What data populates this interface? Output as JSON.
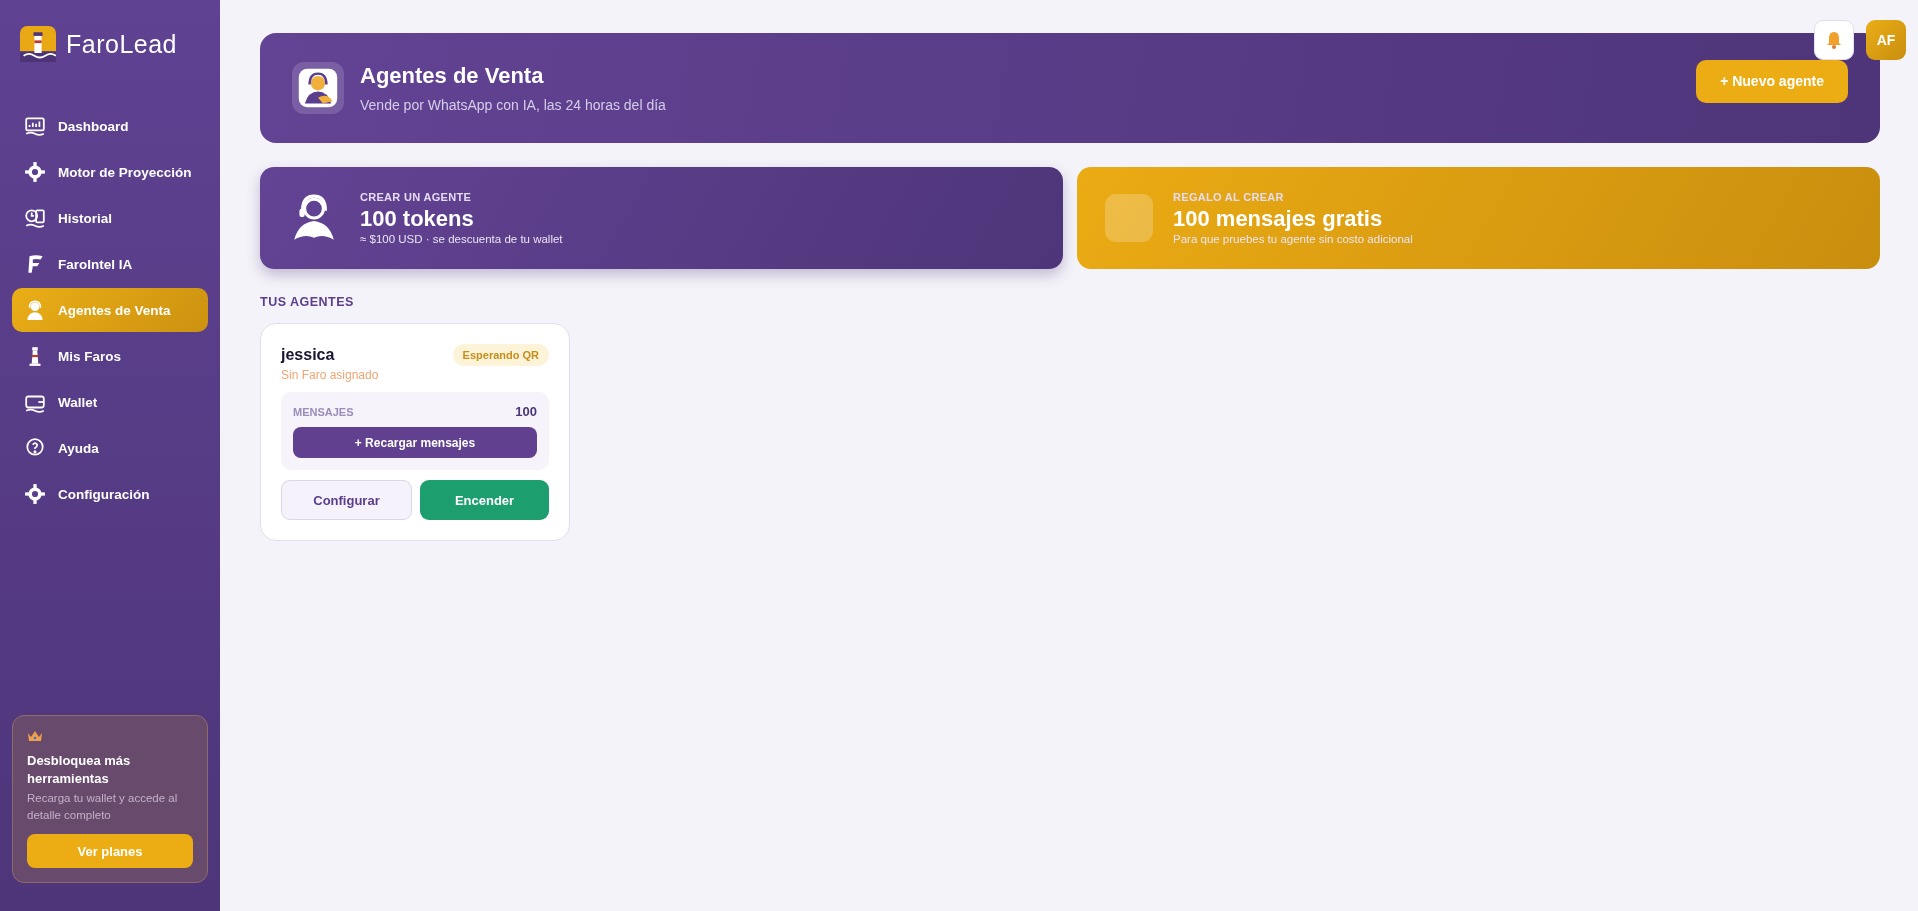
{
  "brand": {
    "name": "FaroLead"
  },
  "sidebar": {
    "items": [
      {
        "label": "Dashboard",
        "selected": false
      },
      {
        "label": "Motor de Proyección",
        "selected": false
      },
      {
        "label": "Historial",
        "selected": false
      },
      {
        "label": "FaroIntel IA",
        "selected": false
      },
      {
        "label": "Agentes de Venta",
        "selected": true
      },
      {
        "label": "Mis Faros",
        "selected": false
      },
      {
        "label": "Wallet",
        "selected": false
      },
      {
        "label": "Ayuda",
        "selected": false
      },
      {
        "label": "Configuración",
        "selected": false
      }
    ],
    "promo": {
      "title": "Desbloquea más herramientas",
      "text": "Recarga tu wallet y accede al detalle completo",
      "button": "Ver planes"
    }
  },
  "topbar": {
    "avatar": "AF"
  },
  "header": {
    "title": "Agentes de Venta",
    "subtitle": "Vende por WhatsApp con IA, las 24 horas del día",
    "button": "+ Nuevo agente"
  },
  "stats": [
    {
      "kind": "purple",
      "eyebrow": "CREAR UN AGENTE",
      "value": "100 tokens",
      "note": "≈ $100 USD · se descuenta de tu wallet"
    },
    {
      "kind": "gold",
      "eyebrow": "REGALO AL CREAR",
      "value": "100 mensajes gratis",
      "note": "Para que pruebes tu agente sin costo adicional"
    }
  ],
  "agents_heading": "TUS AGENTES",
  "agents": [
    {
      "name": "jessica",
      "status": "Esperando QR",
      "faro": "Sin Faro asignado",
      "messages_label": "MENSAJES",
      "messages": "100",
      "recharge": "+ Recargar mensajes",
      "configure": "Configurar",
      "power": "Encender"
    }
  ]
}
